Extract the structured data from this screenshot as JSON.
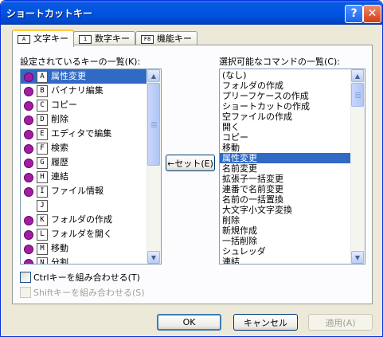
{
  "window": {
    "title": "ショートカットキー",
    "help_icon": "?",
    "close_icon": "✕"
  },
  "tabs": [
    {
      "icon": "A",
      "label": "文字キー",
      "active": true
    },
    {
      "icon": "1",
      "label": "数字キー",
      "active": false
    },
    {
      "icon": "F8",
      "label": "機能キー",
      "active": false
    }
  ],
  "left_list": {
    "label": "設定されているキーの一覧(K):",
    "items": [
      {
        "key": "A",
        "label": "属性変更",
        "assigned": true,
        "selected": true
      },
      {
        "key": "B",
        "label": "バイナリ編集",
        "assigned": true
      },
      {
        "key": "C",
        "label": "コピー",
        "assigned": true
      },
      {
        "key": "D",
        "label": "削除",
        "assigned": true
      },
      {
        "key": "E",
        "label": "エディタで編集",
        "assigned": true
      },
      {
        "key": "F",
        "label": "検索",
        "assigned": true
      },
      {
        "key": "G",
        "label": "履歴",
        "assigned": true
      },
      {
        "key": "H",
        "label": "連結",
        "assigned": true
      },
      {
        "key": "I",
        "label": "ファイル情報",
        "assigned": true
      },
      {
        "key": "J",
        "label": "",
        "assigned": false
      },
      {
        "key": "K",
        "label": "フォルダの作成",
        "assigned": true
      },
      {
        "key": "L",
        "label": "フォルダを開く",
        "assigned": true
      },
      {
        "key": "M",
        "label": "移動",
        "assigned": true
      },
      {
        "key": "N",
        "label": "分割",
        "assigned": true
      }
    ]
  },
  "set_button": {
    "label": "←セット(E)"
  },
  "right_list": {
    "label": "選択可能なコマンドの一覧(C):",
    "items": [
      "(なし)",
      "フォルダの作成",
      "プリーフケースの作成",
      "ショートカットの作成",
      "空ファイルの作成",
      "開く",
      "コピー",
      "移動",
      "属性変更",
      "名前変更",
      "拡張子一括変更",
      "連番で名前変更",
      "名前の一括置換",
      "大文字小文字変換",
      "削除",
      "新規作成",
      "一括削除",
      "シュレッダ",
      "連結"
    ],
    "selected_index": 8
  },
  "checkboxes": {
    "ctrl": {
      "label": "Ctrlキーを組み合わせる(T)",
      "checked": false,
      "enabled": true
    },
    "shift": {
      "label": "Shiftキーを組み合わせる(S)",
      "checked": false,
      "enabled": false
    }
  },
  "buttons": {
    "ok": "OK",
    "cancel": "キャンセル",
    "apply": "適用(A)"
  },
  "colors": {
    "selection": "#316ac5",
    "assigned_dot": "#a01fa0",
    "title_bar": "#0054e3"
  }
}
